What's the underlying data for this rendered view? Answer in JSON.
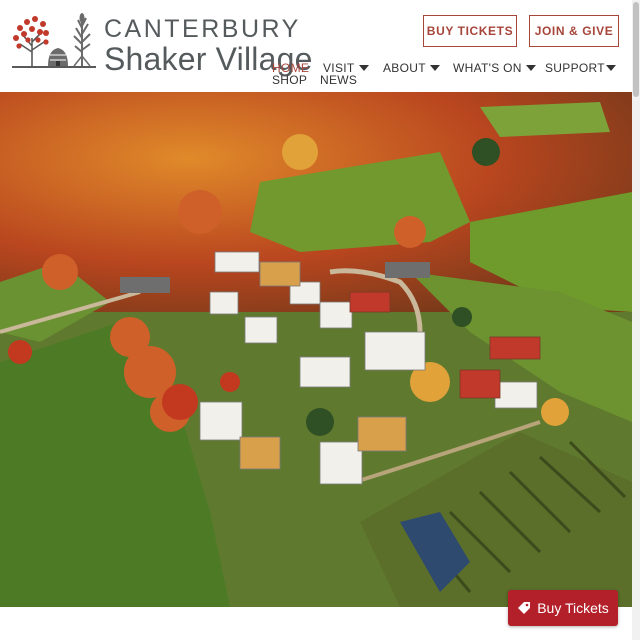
{
  "brand": {
    "line1": "CANTERBURY",
    "line2": "Shaker Village"
  },
  "header_buttons": {
    "buy_tickets": "BUY TICKETS",
    "join_give": "JOIN & GIVE"
  },
  "nav": {
    "home": "HOME",
    "shop": "SHOP",
    "visit": "VISIT",
    "news": "NEWS",
    "about": "ABOUT",
    "whats_on": "WHAT'S ON",
    "support": "SUPPORT"
  },
  "floating_cta": {
    "label": "Buy Tickets",
    "icon": "ticket-tag-icon"
  },
  "colors": {
    "accent": "#a7453a",
    "cta": "#b3202a",
    "brand_text": "#555a5c"
  },
  "hero": {
    "description_icon": "aerial-village-photo"
  }
}
